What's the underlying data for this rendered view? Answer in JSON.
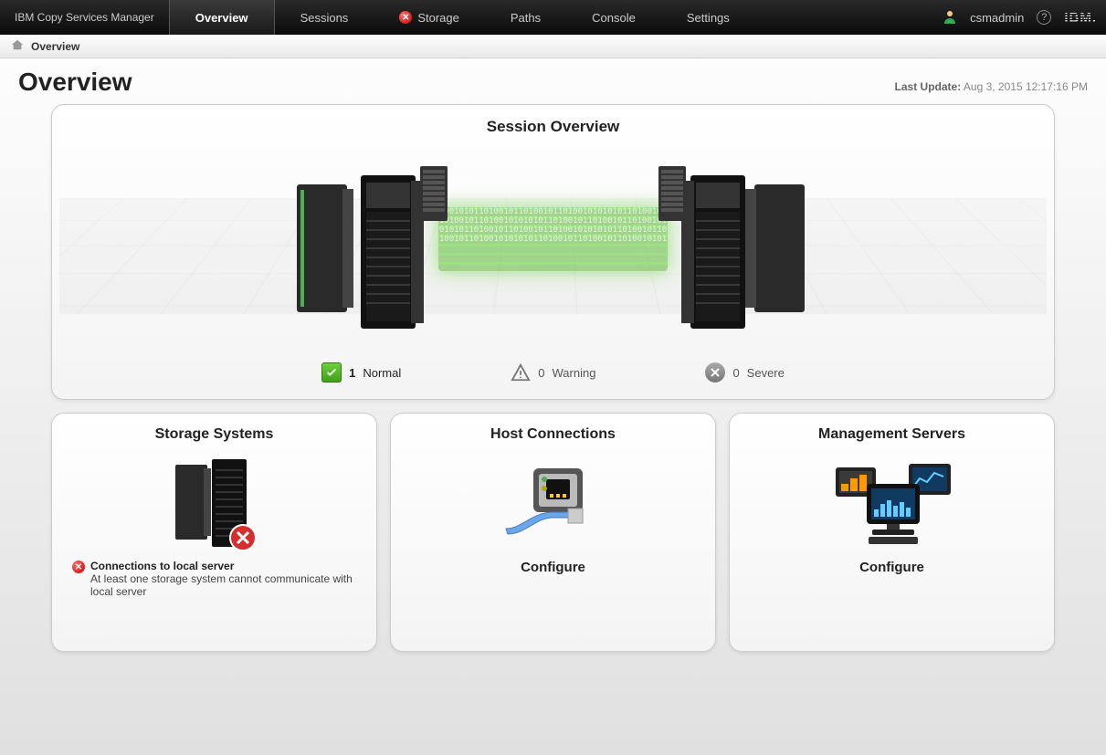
{
  "brand": "IBM Copy Services Manager",
  "nav": {
    "items": [
      {
        "label": "Overview",
        "active": true,
        "error": false
      },
      {
        "label": "Sessions",
        "active": false,
        "error": false
      },
      {
        "label": "Storage",
        "active": false,
        "error": true
      },
      {
        "label": "Paths",
        "active": false,
        "error": false
      },
      {
        "label": "Console",
        "active": false,
        "error": false
      },
      {
        "label": "Settings",
        "active": false,
        "error": false
      }
    ]
  },
  "user": "csmadmin",
  "logo": "IBM.",
  "breadcrumb": "Overview",
  "page_title": "Overview",
  "last_update_label": "Last Update:",
  "last_update_value": "Aug 3, 2015 12:17:16 PM",
  "session_overview": {
    "title": "Session Overview",
    "normal_count": "1",
    "normal_label": "Normal",
    "warning_count": "0",
    "warning_label": "Warning",
    "severe_count": "0",
    "severe_label": "Severe"
  },
  "storage_panel": {
    "title": "Storage Systems",
    "error_title": "Connections to local server",
    "error_detail": "At least one storage system cannot communicate with local server"
  },
  "host_panel": {
    "title": "Host Connections",
    "action": "Configure"
  },
  "mgmt_panel": {
    "title": "Management Servers",
    "action": "Configure"
  }
}
